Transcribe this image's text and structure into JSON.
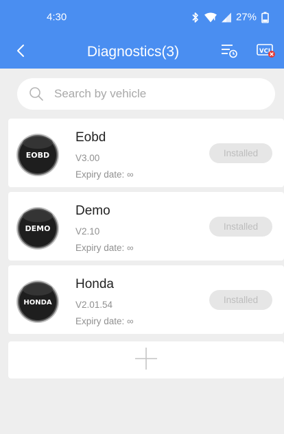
{
  "status_bar": {
    "time": "4:30",
    "battery": "27%"
  },
  "app_bar": {
    "title": "Diagnostics(3)"
  },
  "search": {
    "placeholder": "Search by vehicle"
  },
  "apps": [
    {
      "name": "Eobd",
      "logo_text": "EOBD",
      "version": "V3.00",
      "expiry": "Expiry date: ∞",
      "button": "Installed"
    },
    {
      "name": "Demo",
      "logo_text": "DEMO",
      "version": "V2.10",
      "expiry": "Expiry date: ∞",
      "button": "Installed"
    },
    {
      "name": "Honda",
      "logo_text": "HONDA",
      "version": "V2.01.54",
      "expiry": "Expiry date: ∞",
      "button": "Installed"
    }
  ],
  "colors": {
    "header": "#4a8ef1",
    "background": "#eeeeee",
    "button_bg": "#e6e6e6",
    "button_text": "#bdbdbd",
    "vci_badge": "#e53935"
  },
  "icons": {
    "back": "back-arrow-icon",
    "history": "history-list-icon",
    "vci": "vci-disconnected-icon",
    "search": "search-icon",
    "add": "plus-icon"
  }
}
